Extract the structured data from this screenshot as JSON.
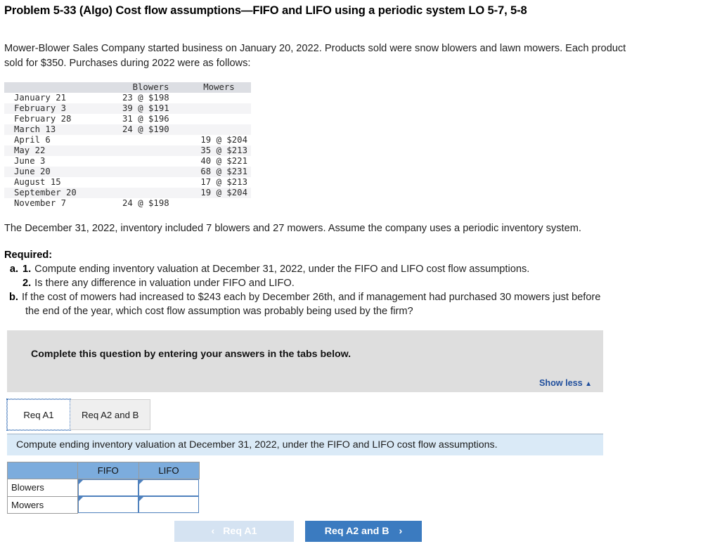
{
  "problem": {
    "title": "Problem 5-33 (Algo) Cost flow assumptions—FIFO and LIFO using a periodic system LO 5-7, 5-8",
    "intro": "Mower-Blower Sales Company started business on January 20, 2022. Products sold were snow blowers and lawn mowers. Each product sold for $350. Purchases during 2022 were as follows:",
    "post_table_note": "The December 31, 2022, inventory included 7 blowers and 27 mowers. Assume the company uses a periodic inventory system."
  },
  "purchases_table": {
    "headers": {
      "date": "",
      "blowers": "Blowers",
      "mowers": "Mowers"
    },
    "rows": [
      {
        "date": "January 21",
        "blowers": "23 @ $198",
        "mowers": "",
        "striped": false
      },
      {
        "date": "February 3",
        "blowers": "39 @ $191",
        "mowers": "",
        "striped": true
      },
      {
        "date": "February 28",
        "blowers": "31 @ $196",
        "mowers": "",
        "striped": false
      },
      {
        "date": "March 13",
        "blowers": "24 @ $190",
        "mowers": "",
        "striped": true
      },
      {
        "date": "April 6",
        "blowers": "",
        "mowers": "19 @ $204",
        "striped": false
      },
      {
        "date": "May 22",
        "blowers": "",
        "mowers": "35 @ $213",
        "striped": true
      },
      {
        "date": "June 3",
        "blowers": "",
        "mowers": "40 @ $221",
        "striped": false
      },
      {
        "date": "June 20",
        "blowers": "",
        "mowers": "68 @ $231",
        "striped": true
      },
      {
        "date": "August 15",
        "blowers": "",
        "mowers": "17 @ $213",
        "striped": false
      },
      {
        "date": "September 20",
        "blowers": "",
        "mowers": "19 @ $204",
        "striped": true
      },
      {
        "date": "November 7",
        "blowers": "24 @ $198",
        "mowers": "",
        "striped": false
      }
    ]
  },
  "required": {
    "heading": "Required:",
    "items": [
      {
        "mark": "a.",
        "num": "1.",
        "text": "Compute ending inventory valuation at December 31, 2022, under the FIFO and LIFO cost flow assumptions."
      },
      {
        "mark": "",
        "num": "2.",
        "text": "Is there any difference in valuation under FIFO and LIFO."
      },
      {
        "mark": "b.",
        "num": "",
        "text": "If the cost of mowers had increased to $243 each by December 26th, and if management had purchased 30 mowers just before"
      },
      {
        "mark": "",
        "num": "",
        "text": "the end of the year, which cost flow assumption was probably being used by the firm?"
      }
    ]
  },
  "gray_panel": {
    "instruction": "Complete this question by entering your answers in the tabs below.",
    "show_less_label": "Show less",
    "show_less_caret": "▲"
  },
  "tabs": [
    {
      "label": "Req A1",
      "active": true
    },
    {
      "label": "Req A2 and B",
      "active": false
    }
  ],
  "blue_bar": {
    "text": "Compute ending inventory valuation at December 31, 2022, under the FIFO and LIFO cost flow assumptions."
  },
  "answer_table": {
    "corner_label": "",
    "columns": [
      "FIFO",
      "LIFO"
    ],
    "rows": [
      {
        "label": "Blowers",
        "fifo": "",
        "lifo": ""
      },
      {
        "label": "Mowers",
        "fifo": "",
        "lifo": ""
      }
    ]
  },
  "nav": {
    "prev_label": "Req A1",
    "prev_chevron": "‹",
    "next_label": "Req A2 and B",
    "next_chevron": "›"
  },
  "colors": {
    "accent_blue": "#3b7bc0",
    "header_blue": "#7cacdd",
    "bar_blue": "#daeaf7",
    "panel_gray": "#dedede",
    "link_blue": "#1f4e9c",
    "input_border": "#4f81bd",
    "disabled_button": "#d5e3f2"
  }
}
